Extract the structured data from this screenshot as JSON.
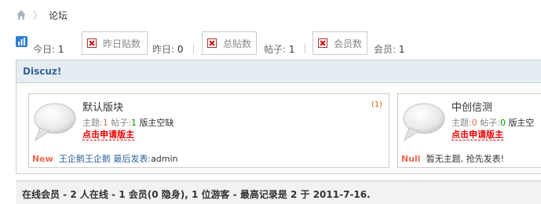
{
  "breadcrumb": {
    "home_icon": "home-icon",
    "separator": "〉",
    "current": "论坛"
  },
  "stats": {
    "today_label": "今日:",
    "today_value": "1",
    "broken_images": [
      "昨日贴数",
      "总贴数",
      "会员数"
    ],
    "yesterday_label": "昨日:",
    "yesterday_value": "0",
    "posts_label": "帖子:",
    "posts_value": "1",
    "members_label": "会员:",
    "members_value": "1"
  },
  "category": {
    "title": "Discuz!"
  },
  "forums": [
    {
      "name": "默认版块",
      "count": "(1)",
      "threads_label": "主题:",
      "threads": "1",
      "posts_label": "帖子:",
      "posts": "1",
      "moderator": "版主空缺",
      "apply": "点击申请版主",
      "last_tag": "New",
      "last_link": "王企鹅王企鹅",
      "last_label": "最后发表:",
      "last_by": "admin"
    },
    {
      "name": "中创信测",
      "count": "",
      "threads_label": "主题:",
      "threads": "0",
      "posts_label": "帖子:",
      "posts": "0",
      "moderator": "版主空",
      "apply": "点击申请版主",
      "last_tag": "Null",
      "last_text": "暂无主题, 抢先发表!"
    }
  ],
  "online": {
    "text": "在线会员 - 2 人在线 - 1 会员(0 隐身), 1 位游客 - 最高记录是 2 于 2011-7-16."
  },
  "colors": {
    "link": "#336699",
    "accent": "#f26c4f",
    "apply": "#ee0000",
    "header_bg": "#e5edf2"
  }
}
